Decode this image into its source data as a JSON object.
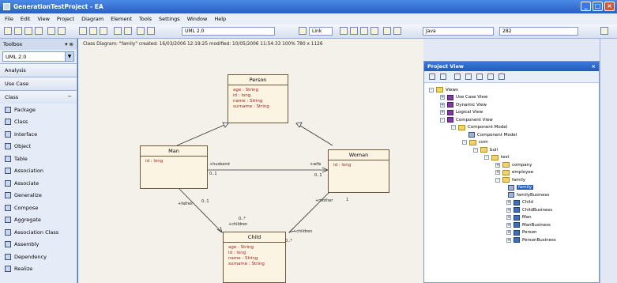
{
  "window": {
    "title": "GenerationTestProject - EA"
  },
  "menu": [
    "File",
    "Edit",
    "View",
    "Project",
    "Diagram",
    "Element",
    "Tools",
    "Settings",
    "Window",
    "Help"
  ],
  "toolbar": {
    "uml_select": "UML 2.0",
    "link_select": "Link",
    "lang_select": "Java",
    "zoom_select": "282"
  },
  "toolbox": {
    "title": "Toolbox",
    "combo": "UML 2.0",
    "sections": [
      "Analysis",
      "Use Case",
      "Class"
    ],
    "items": [
      "Package",
      "Class",
      "Interface",
      "Object",
      "Table",
      "Association",
      "Associate",
      "Generalize",
      "Compose",
      "Aggregate",
      "Association Class",
      "Assembly",
      "Dependency",
      "Realize"
    ]
  },
  "diagram": {
    "header": "Class Diagram: \"family\"   created: 16/03/2006 12:19:25  modified: 10/05/2006 11:54:33   100%   780 x 1126",
    "classes": {
      "person": {
        "name": "Person",
        "attrs": [
          "age : String",
          "id : long",
          "name : String",
          "surname : String"
        ]
      },
      "man": {
        "name": "Man",
        "attrs": [
          "id : long"
        ]
      },
      "woman": {
        "name": "Woman",
        "attrs": [
          "id : long"
        ]
      },
      "child": {
        "name": "Child",
        "attrs": [
          "age : String",
          "id : long",
          "name : String",
          "surname : String"
        ]
      }
    },
    "labels": {
      "husband": "+husband",
      "wife": "+wife",
      "mult_man_husband": "0..1",
      "mult_woman_wife": "0..1",
      "father": "+father",
      "mult_father": "0..1",
      "mother": "+mother",
      "mult_mother": "1",
      "children_left": "+children",
      "mult_children_left": "0..*",
      "children_right": "+children",
      "mult_children_right": "0..*"
    }
  },
  "project_view": {
    "title": "Project View",
    "tree": [
      {
        "label": "Views",
        "icon": "folder",
        "exp": "-"
      },
      {
        "label": "Use Case View",
        "icon": "view",
        "exp": "+"
      },
      {
        "label": "Dynamic View",
        "icon": "view",
        "exp": "+"
      },
      {
        "label": "Logical View",
        "icon": "view",
        "exp": "+"
      },
      {
        "label": "Component View",
        "icon": "view",
        "exp": "-"
      },
      {
        "label": "Component Model",
        "icon": "folder",
        "exp": "-"
      },
      {
        "label": "Component Model",
        "icon": "package",
        "exp": ""
      },
      {
        "label": "com",
        "icon": "folder",
        "exp": "-"
      },
      {
        "label": "bull",
        "icon": "folder",
        "exp": "-"
      },
      {
        "label": "test",
        "icon": "folder",
        "exp": "-"
      },
      {
        "label": "company",
        "icon": "folder",
        "exp": "+"
      },
      {
        "label": "employee",
        "icon": "folder",
        "exp": "+"
      },
      {
        "label": "family",
        "icon": "folder",
        "exp": "-"
      },
      {
        "label": "family",
        "icon": "package",
        "exp": ""
      },
      {
        "label": "familyBusiness",
        "icon": "package",
        "exp": ""
      },
      {
        "label": "Child",
        "icon": "class",
        "exp": "+"
      },
      {
        "label": "ChildBusiness",
        "icon": "class",
        "exp": "+"
      },
      {
        "label": "Man",
        "icon": "class",
        "exp": "+"
      },
      {
        "label": "ManBusiness",
        "icon": "class",
        "exp": "+"
      },
      {
        "label": "Person",
        "icon": "class",
        "exp": "+"
      },
      {
        "label": "PersonBusiness",
        "icon": "class",
        "exp": "+"
      }
    ]
  }
}
